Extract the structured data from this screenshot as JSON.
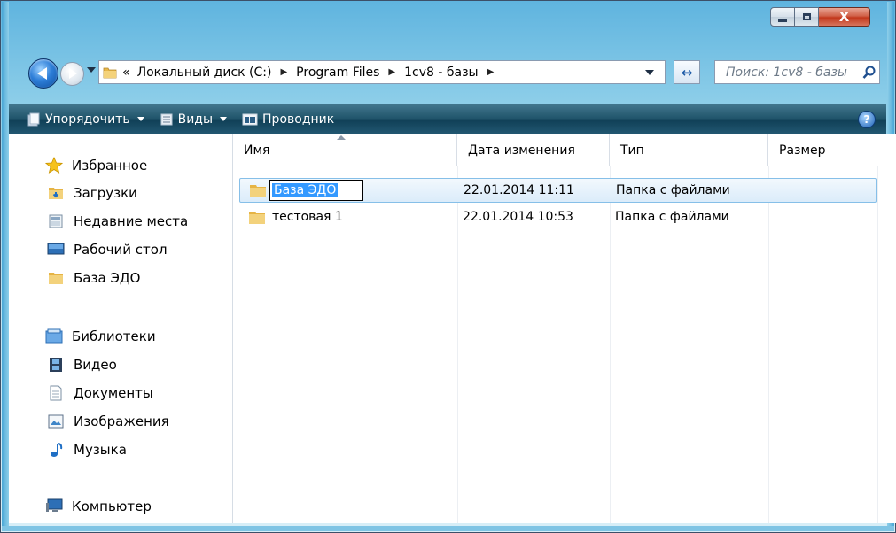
{
  "window": {
    "caption_buttons": {
      "minimize_label": "—",
      "maximize_label": "□",
      "close_label": "X"
    }
  },
  "navigation": {
    "back_icon": "back-arrow-icon",
    "forward_icon": "forward-arrow-icon",
    "address": {
      "overflow": "«",
      "crumbs": [
        "Локальный диск (C:)",
        "Program Files",
        "1cv8 - базы"
      ],
      "separator": "▶"
    },
    "refresh_glyph": "↔",
    "search": {
      "placeholder": "Поиск: 1cv8 - базы"
    }
  },
  "toolbar": {
    "organize_label": "Упорядочить",
    "views_label": "Виды",
    "explorer_label": "Проводник",
    "help_label": "?"
  },
  "sidebar": {
    "favorites": {
      "header": "Избранное",
      "items": [
        {
          "label": "Загрузки",
          "icon": "downloads-folder-icon"
        },
        {
          "label": "Недавние места",
          "icon": "recent-places-icon"
        },
        {
          "label": "Рабочий стол",
          "icon": "desktop-icon"
        },
        {
          "label": "База ЭДО",
          "icon": "folder-icon"
        }
      ]
    },
    "libraries": {
      "header": "Библиотеки",
      "items": [
        {
          "label": "Видео",
          "icon": "video-icon"
        },
        {
          "label": "Документы",
          "icon": "documents-icon"
        },
        {
          "label": "Изображения",
          "icon": "pictures-icon"
        },
        {
          "label": "Музыка",
          "icon": "music-icon"
        }
      ]
    },
    "computer": {
      "label": "Компьютер",
      "icon": "computer-icon"
    }
  },
  "file_list": {
    "columns": [
      "Имя",
      "Дата изменения",
      "Тип",
      "Размер"
    ],
    "rows": [
      {
        "name": "База ЭДО",
        "date": "22.01.2014 11:11",
        "type": "Папка с файлами",
        "size": "",
        "selected": true,
        "renaming": true
      },
      {
        "name": "тестовая 1",
        "date": "22.01.2014 10:53",
        "type": "Папка с файлами",
        "size": "",
        "selected": false,
        "renaming": false
      }
    ]
  },
  "colors": {
    "toolbar_bg": "#1f5369",
    "selection_bg": "#dbecfa",
    "selection_border": "#86bfe8",
    "rename_highlight": "#3399ff",
    "frame": "#8fcfe9"
  }
}
